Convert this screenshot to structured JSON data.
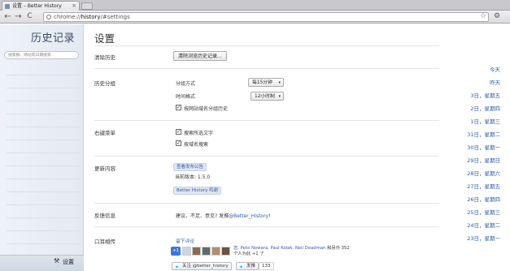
{
  "browser": {
    "tab_title": "设置 – Better History",
    "tab_close": "×",
    "back": "←",
    "forward": "→",
    "reload": "C",
    "url_scheme": "chrome://",
    "url_host": "history",
    "url_path": "/#settings",
    "star": "☆",
    "wrench": "🔧"
  },
  "sidebar": {
    "title": "历史记录",
    "search_placeholder": "搜索群、网站或日期搜索",
    "days": [
      "今天",
      "昨天",
      "3日，星期五",
      "2日，星期四",
      "1日，星期三",
      "31日，星期二",
      "30日，星期一",
      "29日，星期日",
      "28日，星期六",
      "27日，星期五",
      "26日，星期四",
      "25日，星期三",
      "24日，星期二",
      "23日，星期一"
    ],
    "settings_label": "设置"
  },
  "main": {
    "title": "设置",
    "clear": {
      "label": "清除历史",
      "button": "清除浏览历史记录..."
    },
    "grouping": {
      "label": "历史分组",
      "group_by_label": "分组方式",
      "group_by_value": "每15分钟",
      "time_format_label": "时间格式",
      "time_format_value": "12小时制",
      "domain_check_label": "按网站域名分组历史",
      "domain_checked": true
    },
    "context_menu": {
      "label": "右键菜单",
      "search_selected": "搜索所选文字",
      "search_domain": "按域名搜索"
    },
    "updates": {
      "label": "更新内容",
      "notes_link": "查看发布公告",
      "version": "当前版本: 1.5.0",
      "thanks": "Better History 鸣谢"
    },
    "feedback": {
      "label": "反馈信息",
      "text_before": "建议、不足、意见? 发推",
      "handle": "@Better_History",
      "text_after": "!"
    },
    "word_of_mouth": {
      "label": "口耳相传",
      "comment_link": "留下评论",
      "plus_button": "+1",
      "plus_text_names": "您, Pete Nowara, Paul Kolak, Neil Deadman",
      "plus_text_rest": "和另外 352",
      "plus_text_line2": "个人为此 +1 了",
      "follow_button": "关注 @better_history",
      "tweet_button": "发推",
      "tweet_count": "133"
    }
  },
  "colors": {
    "link": "#2f5ba8",
    "sidebar_bg": "#e8edf5"
  }
}
